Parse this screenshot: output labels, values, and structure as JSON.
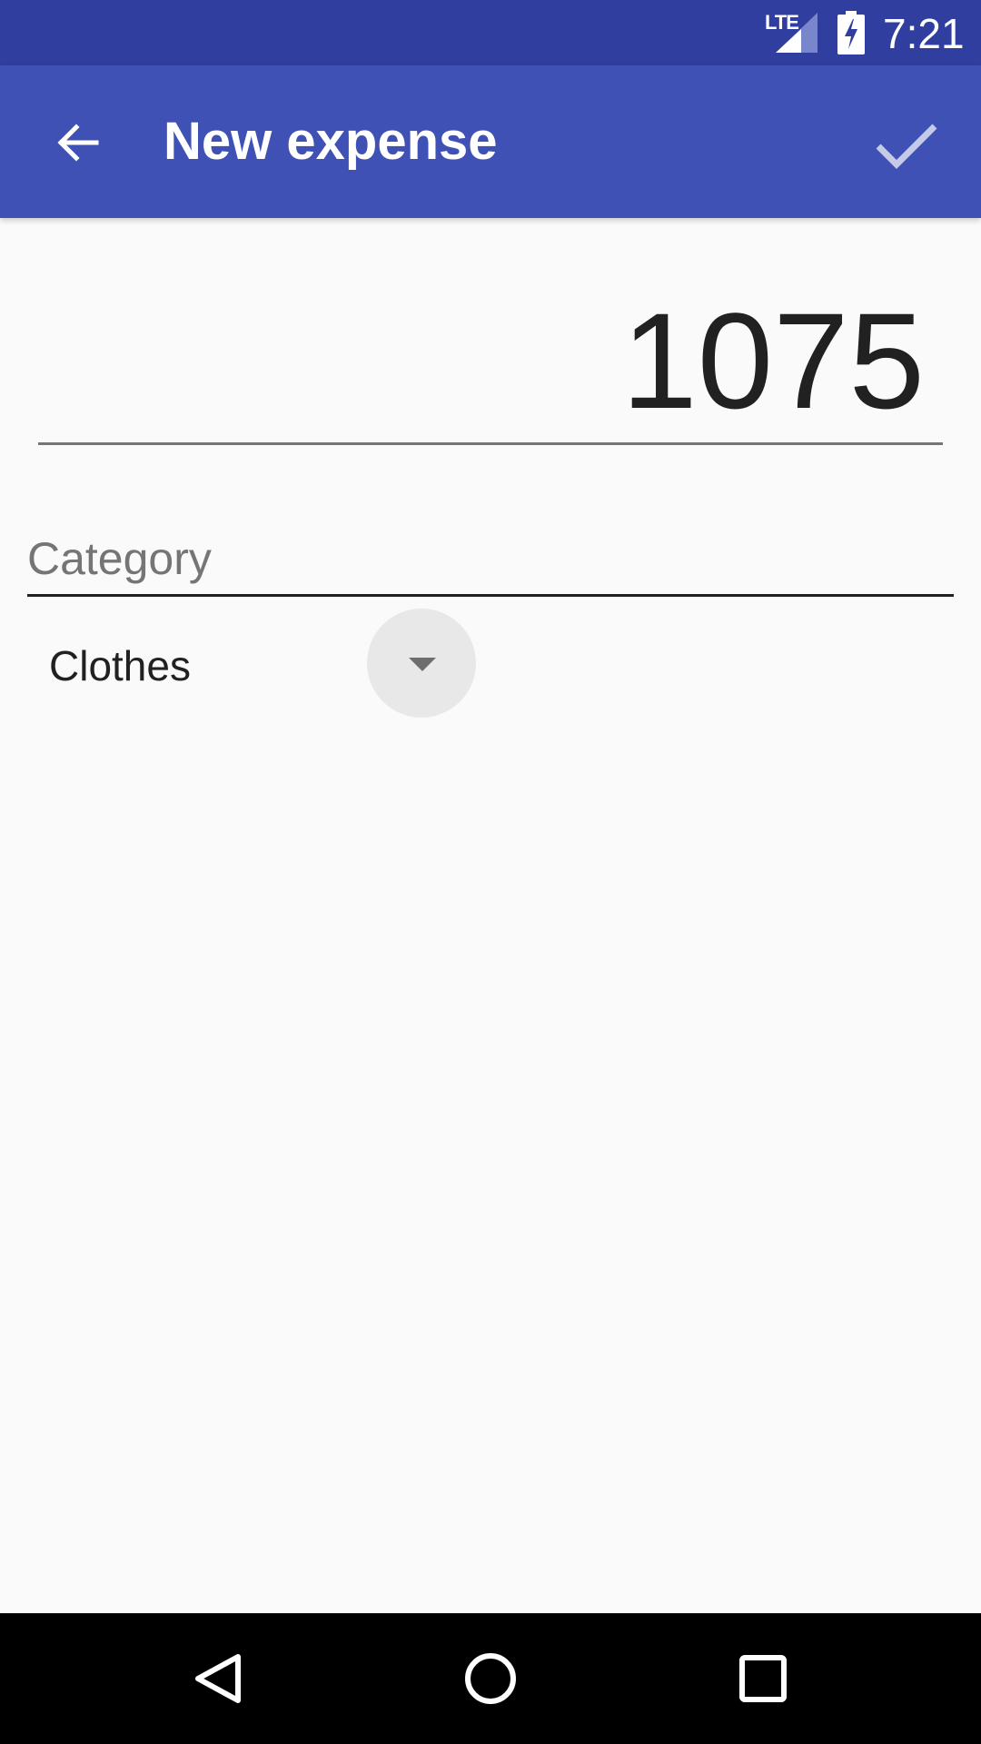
{
  "status_bar": {
    "network": "LTE",
    "time": "7:21",
    "signal_icon": "signal-icon",
    "battery_icon": "battery-charging-icon"
  },
  "app_bar": {
    "title": "New expense",
    "back_icon": "arrow-back-icon",
    "confirm_icon": "check-icon",
    "color": "#3f51b5",
    "status_color": "#303f9f"
  },
  "form": {
    "amount": "1075",
    "category_label": "Category",
    "category_value": "Clothes",
    "dropdown_icon": "chevron-down-icon"
  },
  "nav_bar": {
    "back_icon": "nav-back-icon",
    "home_icon": "nav-home-icon",
    "recents_icon": "nav-recents-icon"
  }
}
